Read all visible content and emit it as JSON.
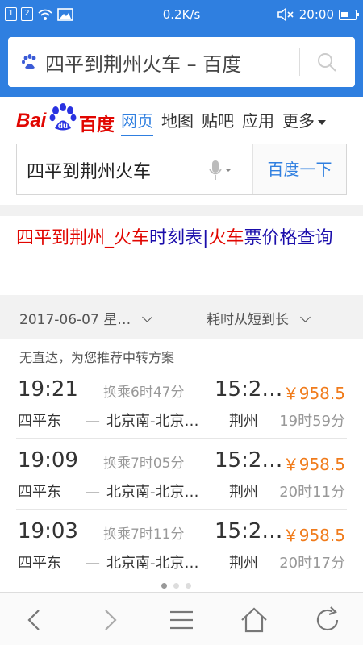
{
  "status_bar": {
    "sim1": "1",
    "sim2": "2",
    "speed": "0.2K/s",
    "time": "20:00"
  },
  "url_bar": {
    "title": "四平到荆州火车 – 百度"
  },
  "baidu_header": {
    "logo_text_latin": "Bai",
    "logo_text_du": "du",
    "logo_text_cn": "百度",
    "nav": [
      "网页",
      "地图",
      "贴吧",
      "应用",
      "更多"
    ],
    "active_nav": "网页"
  },
  "search": {
    "query": "四平到荆州火车",
    "button_label": "百度一下"
  },
  "result": {
    "title_parts": [
      {
        "text": "四平到荆州_",
        "red": true
      },
      {
        "text": "火车",
        "red": true
      },
      {
        "text": "时刻表|",
        "red": false
      },
      {
        "text": "火车",
        "red": true
      },
      {
        "text": "票价格查询",
        "red": false
      }
    ],
    "date_filter": "2017-06-07 星…",
    "sort_filter": "耗时从短到长",
    "notice": "无直达，为您推荐中转方案"
  },
  "trains": [
    {
      "depart": "19:21",
      "transfer": "换乘6时47分",
      "arrive": "15:2…",
      "price": "￥958.5",
      "from": "四平东",
      "via": "北京南-北京…",
      "to": "荆州",
      "duration": "19时59分"
    },
    {
      "depart": "19:09",
      "transfer": "换乘7时05分",
      "arrive": "15:2…",
      "price": "￥958.5",
      "from": "四平东",
      "via": "北京南-北京…",
      "to": "荆州",
      "duration": "20时11分"
    },
    {
      "depart": "19:03",
      "transfer": "换乘7时11分",
      "arrive": "15:2…",
      "price": "￥958.5",
      "from": "四平东",
      "via": "北京南-北京…",
      "to": "荆州",
      "duration": "20时17分"
    }
  ],
  "pager": {
    "pages": 3,
    "current": 1
  },
  "colors": {
    "brand_blue": "#2f7fe0",
    "baidu_red": "#e10601",
    "price_orange": "#f07b1b"
  }
}
